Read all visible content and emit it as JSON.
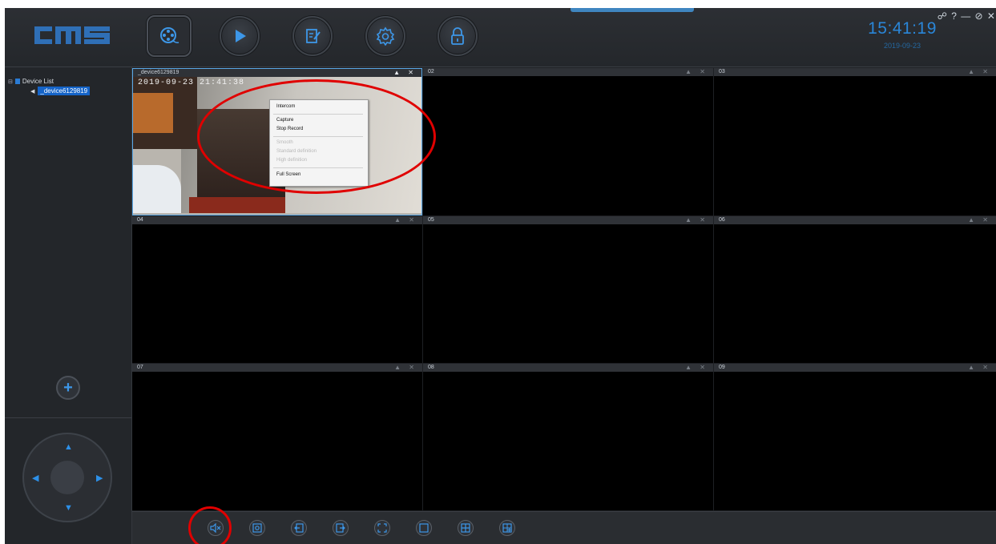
{
  "app": {
    "logo_text": "cms"
  },
  "header": {
    "nav": [
      {
        "name": "live-view",
        "icon": "film-reel-icon",
        "active": true
      },
      {
        "name": "playback",
        "icon": "play-icon"
      },
      {
        "name": "log",
        "icon": "edit-note-icon"
      },
      {
        "name": "settings",
        "icon": "gear-icon"
      },
      {
        "name": "lock",
        "icon": "padlock-icon"
      }
    ],
    "time": "15:41:19",
    "date": "2019-09-23",
    "window_controls": "☍ ? — ⊘ ✕"
  },
  "sidebar": {
    "tree_root": "Device List",
    "device": "_device6129819",
    "add_label": "+"
  },
  "grid": {
    "cells": [
      {
        "title": "_device6129819",
        "active": true
      },
      {
        "title": "02"
      },
      {
        "title": "03"
      },
      {
        "title": "04"
      },
      {
        "title": "05"
      },
      {
        "title": "06"
      },
      {
        "title": "07"
      },
      {
        "title": "08"
      },
      {
        "title": "09"
      }
    ],
    "timestamp": "2019-09-23  21:41:38",
    "cell_controls": "▲ ✕"
  },
  "context_menu": {
    "items": [
      {
        "label": "Intercom",
        "enabled": true
      },
      {
        "label": "Capture",
        "enabled": true
      },
      {
        "label": "Stop Record",
        "enabled": true
      },
      {
        "label": "Smooth",
        "enabled": false
      },
      {
        "label": "Standard definition",
        "enabled": false
      },
      {
        "label": "High definition",
        "enabled": false
      },
      {
        "label": "Full Screen",
        "enabled": true
      }
    ]
  },
  "toolbar": {
    "buttons": [
      {
        "name": "mute",
        "icon": "mute-speaker-icon"
      },
      {
        "name": "snapshot",
        "icon": "snapshot-icon"
      },
      {
        "name": "prev-page",
        "icon": "page-prev-icon"
      },
      {
        "name": "next-page",
        "icon": "page-next-icon"
      },
      {
        "name": "fullscreen",
        "icon": "fullscreen-icon"
      },
      {
        "name": "layout-1",
        "icon": "single-view-icon"
      },
      {
        "name": "layout-4",
        "icon": "quad-view-icon"
      },
      {
        "name": "layout-custom",
        "icon": "multi-view-icon"
      }
    ]
  },
  "colors": {
    "accent": "#2a86d8",
    "annotation": "#e00000",
    "selected": "#1564c8"
  }
}
